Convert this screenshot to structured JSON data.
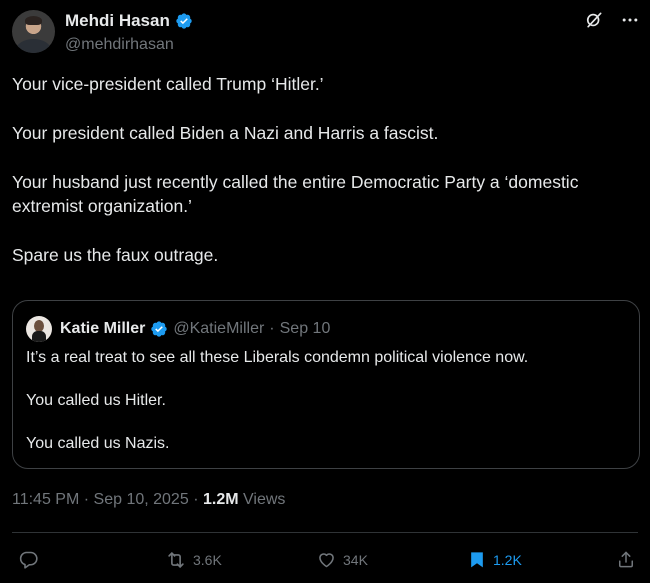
{
  "author": {
    "display_name": "Mehdi Hasan",
    "handle": "@mehdirhasan",
    "verified": true
  },
  "top_actions": {
    "grok_icon": "grok-icon",
    "more_icon": "more-icon"
  },
  "tweet": {
    "paragraphs": [
      "Your vice-president called Trump ‘Hitler.’",
      "Your president called Biden a Nazi and Harris a fascist.",
      "Your husband just recently called the entire Democratic Party a ‘domestic extremist organization.’",
      "Spare us the faux outrage."
    ],
    "time": "11:45 PM",
    "date": "Sep 10, 2025",
    "views_count": "1.2M",
    "views_label": "Views"
  },
  "quote": {
    "display_name": "Katie Miller",
    "handle": "@KatieMiller",
    "date": "Sep 10",
    "paragraphs": [
      "It’s a real treat to see all these Liberals condemn political violence now.",
      "You called us Hitler.",
      "You called us Nazis."
    ]
  },
  "actions": {
    "reply": {
      "icon": "reply-icon",
      "count": ""
    },
    "repost": {
      "icon": "repost-icon",
      "count": "3.6K"
    },
    "like": {
      "icon": "heart-icon",
      "count": "34K"
    },
    "bookmark": {
      "icon": "bookmark-icon",
      "count": "1.2K"
    },
    "share": {
      "icon": "share-icon"
    }
  },
  "colors": {
    "background": "#000000",
    "text": "#e7e9ea",
    "secondary": "#71767b",
    "accent": "#1d9bf0"
  }
}
